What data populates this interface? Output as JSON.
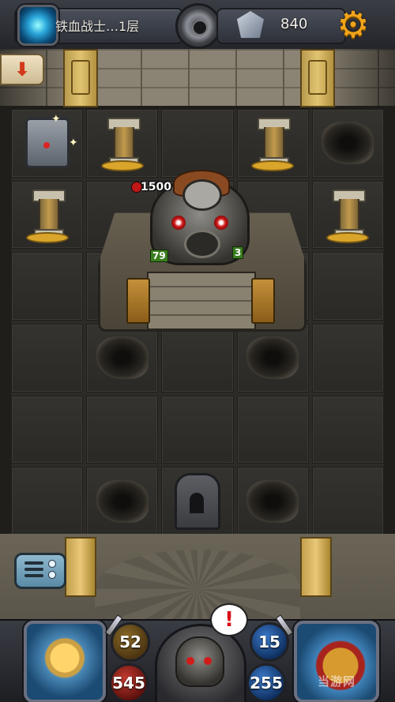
{
  "header": {
    "level_title": "铁血战士…1层",
    "crystal_count": "840",
    "icons": {
      "portal": "portal-icon",
      "center_gear": "gear-wheel-icon",
      "crystal": "crystal-icon",
      "settings": "settings-gear-icon"
    }
  },
  "exit_button": {
    "glyph": "⬇"
  },
  "boss": {
    "hp": "1500",
    "attack": "79",
    "defense": "3"
  },
  "hud": {
    "attack": "52",
    "hp": "545",
    "defense": "15",
    "mana": "255",
    "alert_glyph": "!"
  },
  "watermark": "当游网"
}
